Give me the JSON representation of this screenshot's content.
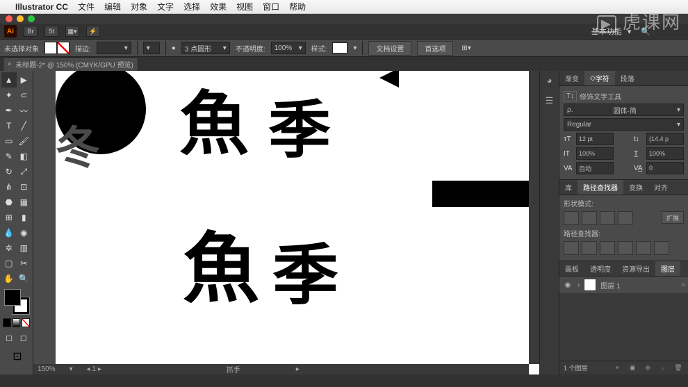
{
  "menubar": {
    "app": "Illustrator CC",
    "items": [
      "文件",
      "编辑",
      "对象",
      "文字",
      "选择",
      "效果",
      "视图",
      "窗口",
      "帮助"
    ]
  },
  "topbar": {
    "ai": "Ai",
    "basic": "基本功能"
  },
  "watermark": "虎课网",
  "control": {
    "no_selection": "未选择对象",
    "stroke_label": "描边:",
    "stroke_val": "",
    "brush_val": "3 点圆形",
    "opacity_label": "不透明度:",
    "opacity_val": "100%",
    "style_label": "样式:",
    "doc_setup": "文档设置",
    "prefs": "首选项"
  },
  "doc_tab": {
    "title": "未标题-2* @ 150% (CMYK/GPU 预览)"
  },
  "scroll": {
    "zoom": "150%",
    "tool": "抓手"
  },
  "panels": {
    "gradient": "渐变",
    "character": "字符",
    "paragraph": "段落",
    "touch_type": "修饰文字工具",
    "font_family": "圆体-简",
    "font_style": "Regular",
    "size": "12 pt",
    "leading": "(14.4 p",
    "h_scale": "100%",
    "v_scale": "100%",
    "tracking": "自动",
    "baseline": "0",
    "lib": "库",
    "pathfinder": "路径查找器",
    "transform": "变换",
    "align": "对齐",
    "shape_mode": "形状模式:",
    "expand": "扩展",
    "pathfinder_label": "路径查找器:",
    "artboard": "画板",
    "transparency": "透明度",
    "asset_export": "资源导出",
    "layers": "图层",
    "layer1": "图层 1",
    "layer_count": "1 个图层"
  }
}
